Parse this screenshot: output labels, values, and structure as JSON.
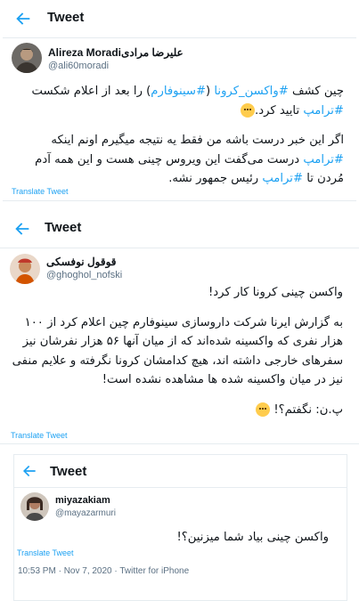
{
  "tweets": [
    {
      "header_title": "Tweet",
      "name": "Alireza Moradiعلیرضا مرادی",
      "handle": "@ali60moradi",
      "paragraphs": [
        [
          {
            "t": "چین کشف "
          },
          {
            "t": "#واکسن_کرونا",
            "tag": true
          },
          {
            "t": " ("
          },
          {
            "t": "#سینوفارم",
            "tag": true
          },
          {
            "t": ") را بعد از اعلام شکست "
          },
          {
            "t": "#ترامپ",
            "tag": true
          },
          {
            "t": " تایید کرد."
          },
          {
            "emoji": "thinking-face"
          }
        ],
        [
          {
            "t": "اگر این خبر درست باشه من فقط یه نتیجه میگیرم اونم اینکه "
          },
          {
            "t": "#ترامپ",
            "tag": true
          },
          {
            "t": " درست می‌گفت این ویروس چینی هست و این همه آدم مُردن تا "
          },
          {
            "t": "#ترامپ",
            "tag": true
          },
          {
            "t": " رئیس جمهور نشه."
          }
        ]
      ],
      "translate": "Translate Tweet"
    },
    {
      "header_title": "Tweet",
      "name": "قوقول نوفسکی",
      "handle": "@ghoghol_nofski",
      "paragraphs": [
        [
          {
            "t": "واکسن چینی کرونا کار کرد!"
          }
        ],
        [
          {
            "t": "به گزارش ایرنا شرکت داروسازی سینوفارم چین اعلام کرد از ۱۰۰ هزار نفری که واکسینه شده‌اند که از میان آنها ۵۶ هزار نفرشان نیز سفرهای خارجی داشته اند، هیچ کدامشان کرونا نگرفته و علایم منفی نیز در میان واکسینه شده ها مشاهده نشده است!"
          }
        ],
        [
          {
            "t": "پ.ن: نگفتم؟! "
          },
          {
            "emoji": "woozy-face"
          }
        ]
      ],
      "translate": "Translate Tweet"
    },
    {
      "header_title": "Tweet",
      "name": "miyazakiam",
      "handle": "@mayazarmuri",
      "paragraphs": [
        [
          {
            "t": "واکسن چینی بیاد شما میزنین؟!"
          }
        ]
      ],
      "translate": "Translate Tweet",
      "meta": "10:53 PM · Nov 7, 2020 · Twitter for iPhone"
    }
  ],
  "colors": {
    "accent": "#1da1f2",
    "secondary": "#5b7083",
    "text": "#0f1419",
    "border": "#e6ecf0"
  }
}
